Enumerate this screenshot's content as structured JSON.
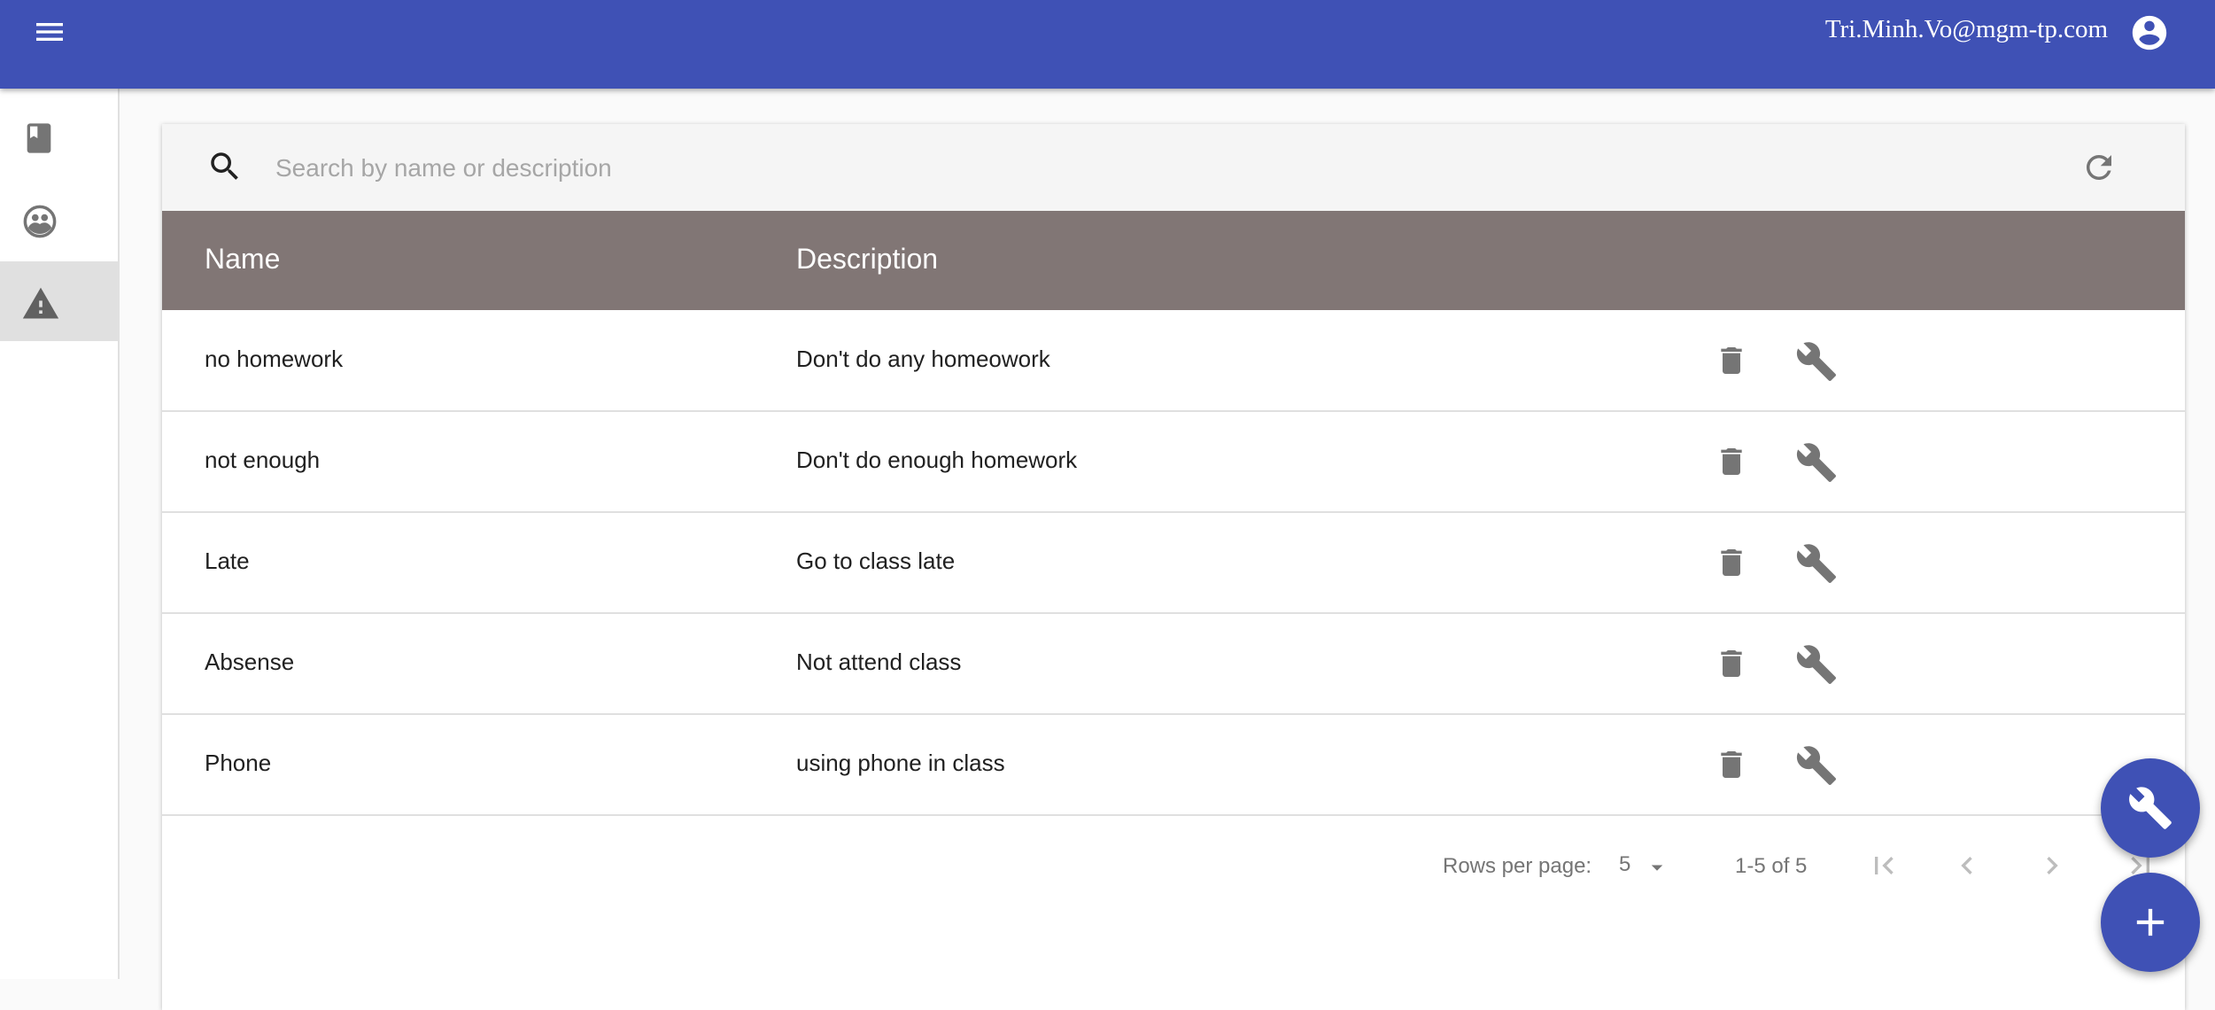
{
  "header": {
    "user_email": "Tri.Minh.Vo@mgm-tp.com",
    "background_color": "#3f51b5",
    "menu_icon": "menu-icon",
    "account_icon": "account-circle-icon"
  },
  "sidebar": {
    "items": [
      {
        "name": "book",
        "icon": "book-icon",
        "active": false
      },
      {
        "name": "students",
        "icon": "group-face-icon",
        "active": false
      },
      {
        "name": "violations",
        "icon": "warning-icon",
        "active": true
      }
    ]
  },
  "search": {
    "placeholder": "Search by name or description",
    "value": "",
    "icon": "search-icon",
    "refresh_icon": "refresh-icon"
  },
  "table": {
    "header_color": "#817675",
    "columns": [
      "Name",
      "Description"
    ],
    "rows": [
      {
        "name": "no homework",
        "description": "Don't do any homeowork"
      },
      {
        "name": "not enough",
        "description": "Don't do enough homework"
      },
      {
        "name": "Late",
        "description": "Go to class late"
      },
      {
        "name": "Absense",
        "description": "Not attend class"
      },
      {
        "name": "Phone",
        "description": "using phone in class"
      }
    ],
    "row_actions": [
      "delete-icon",
      "wrench-icon"
    ]
  },
  "pagination": {
    "rows_per_page_label": "Rows per page:",
    "rows_per_page": "5",
    "range": "1-5 of 5",
    "buttons": [
      "first-page-icon",
      "previous-page-icon",
      "next-page-icon",
      "last-page-icon"
    ]
  },
  "fabs": [
    {
      "name": "tools",
      "icon": "wrench-icon"
    },
    {
      "name": "add",
      "icon": "plus-icon"
    }
  ]
}
